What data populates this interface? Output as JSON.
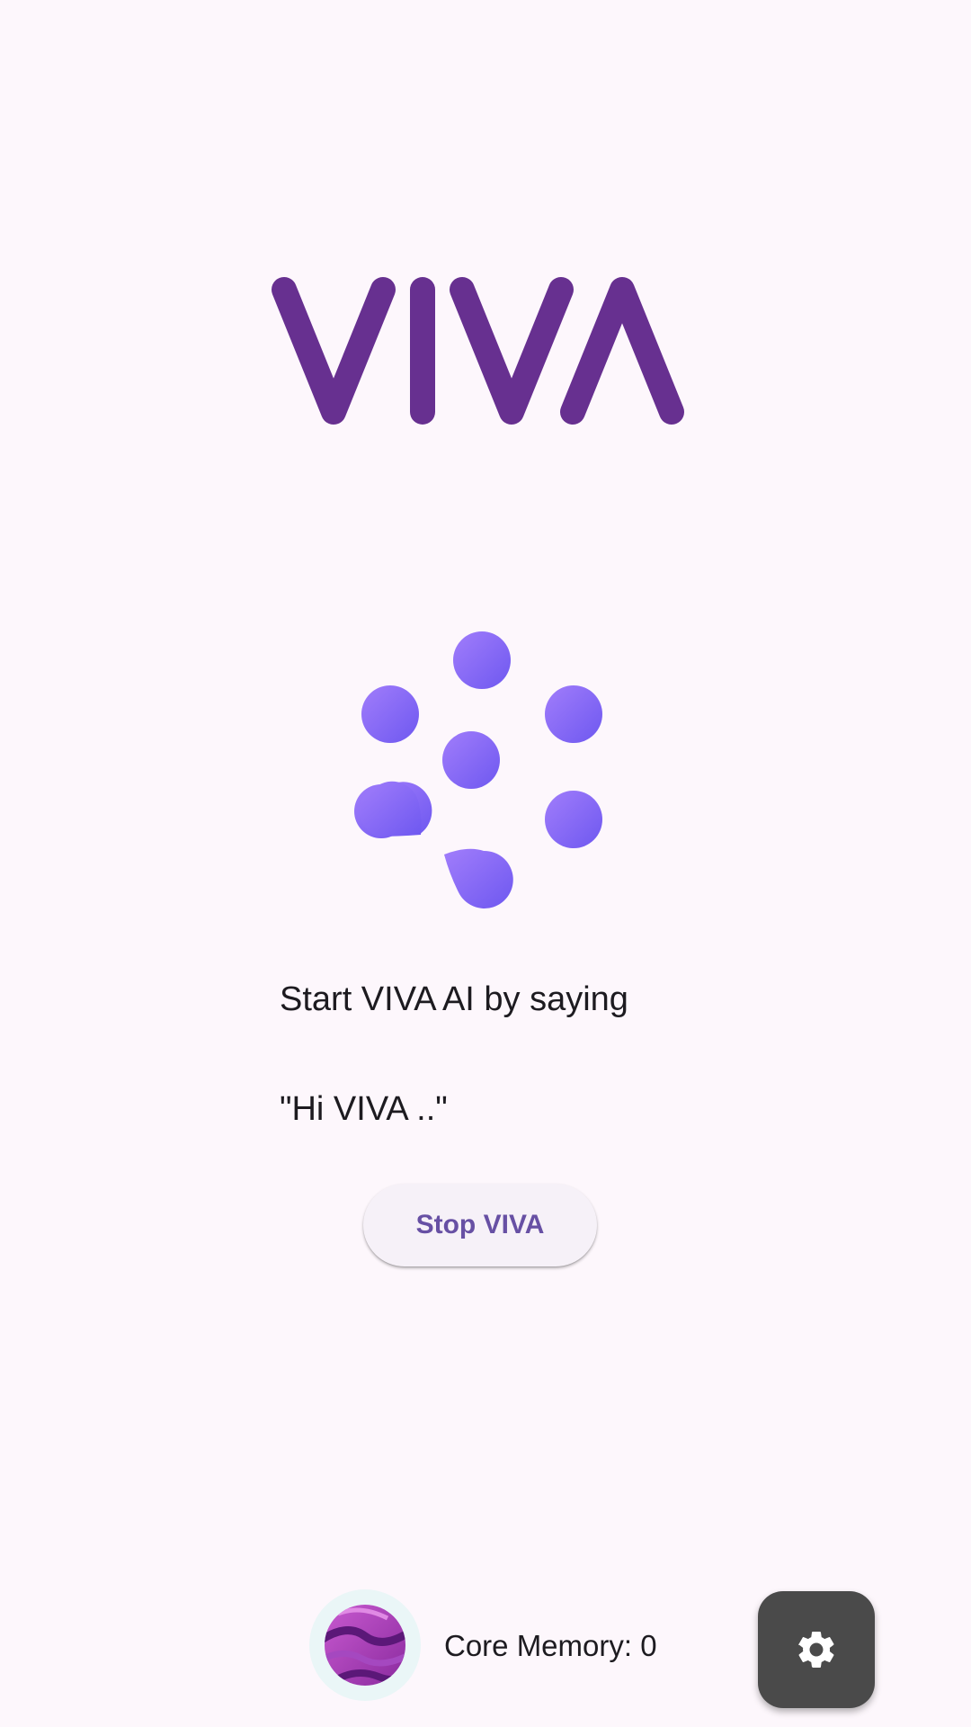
{
  "app": {
    "logo_text": "VIVA",
    "accent_color": "#673090",
    "orb_color": "#8a6cf5",
    "orb_icon": "ai-dots-orb-icon"
  },
  "prompt": {
    "line1": "Start VIVA AI by saying",
    "line2": "\"Hi VIVA ..\""
  },
  "actions": {
    "stop_label": "Stop VIVA",
    "button_text_color": "#6750a4"
  },
  "footer": {
    "avatar_icon": "memory-avatar-icon",
    "memory_label": "Core Memory: ",
    "memory_count": "0",
    "settings_icon": "gear-icon"
  }
}
